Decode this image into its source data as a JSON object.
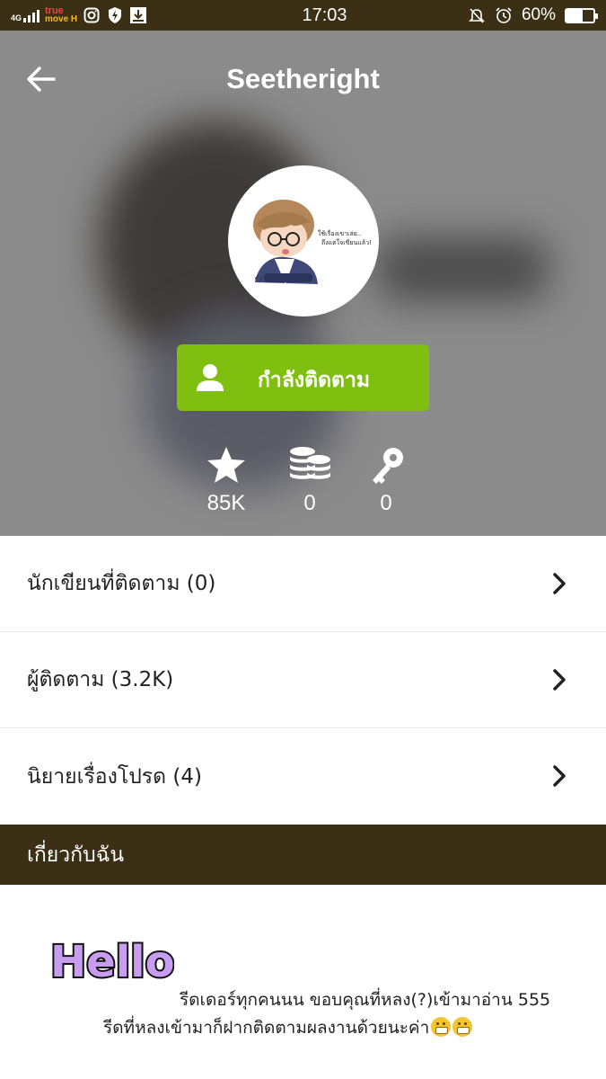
{
  "status_bar": {
    "network": "4G",
    "carrier_line1": "true",
    "carrier_line2": "move H",
    "time": "17:03",
    "battery": "60%",
    "battery_level": 0.6
  },
  "header": {
    "title": "Seetheright"
  },
  "profile": {
    "follow_label": "กำลังติดตาม",
    "follow_color": "#7fbf0f"
  },
  "stats": [
    {
      "icon": "star-icon",
      "value": "85K"
    },
    {
      "icon": "coins-icon",
      "value": "0"
    },
    {
      "icon": "key-icon",
      "value": "0"
    }
  ],
  "menu": [
    {
      "label": "นักเขียนที่ติดตาม (0)"
    },
    {
      "label": "ผู้ติดตาม (3.2K)"
    },
    {
      "label": "นิยายเรื่องโปรด (4)"
    }
  ],
  "about": {
    "header": "เกี่ยวกับฉัน",
    "line1": "รีดเดอร์ทุกคนนน ขอบคุณที่หลง(?)เข้ามาอ่าน 555",
    "line2": "รีดที่หลงเข้ามาก็ฝากติดตามผลงานด้วยนะค่า",
    "hello_image_text": "Hello!"
  },
  "colors": {
    "brand_dark": "#3b2f16",
    "hero_bg": "#8b8b8b"
  }
}
